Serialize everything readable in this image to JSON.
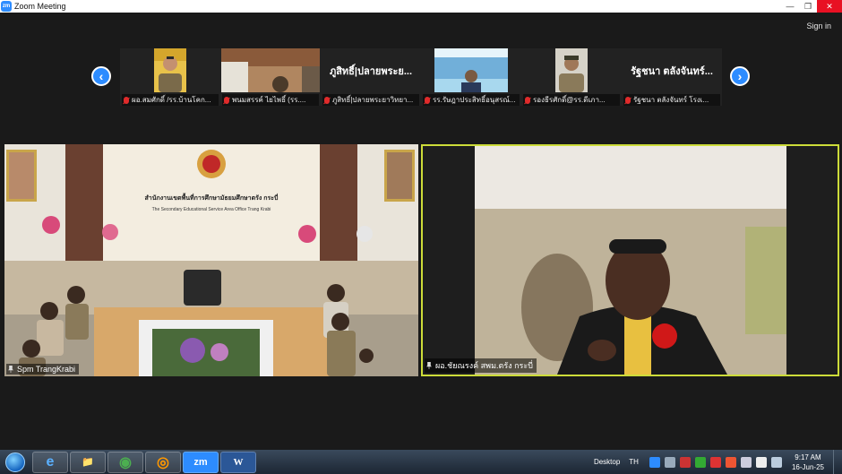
{
  "titlebar": {
    "app_icon_text": "zm",
    "title": "Zoom Meeting",
    "minimize": "—",
    "maximize": "❐",
    "close": "✕"
  },
  "header": {
    "signin": "Sign in"
  },
  "nav": {
    "prev": "‹",
    "next": "›"
  },
  "thumbnails": [
    {
      "name": "ผอ.สมศักดิ์ /รร.บ้านโคก...",
      "muted": true
    },
    {
      "name": "พนมสรรค์ ไยไพธิ์ (รร....",
      "muted": true
    },
    {
      "name": "ภูสิทธิ์|ปลายพระยาวิทยา...",
      "title": "ภูสิทธิ์|ปลายพระย...",
      "muted": true
    },
    {
      "name": "รร.รัษฎาประสิทธิ์อนุสรณ์...",
      "muted": true
    },
    {
      "name": "รองธีรศักดิ์@รร.ดีเภา...",
      "muted": true
    },
    {
      "name": "รัฐชนา ตลังจันทร์ โรงเ...",
      "title": "รัฐชนา ตลังจันทร์...",
      "muted": true
    }
  ],
  "tiles": {
    "left": {
      "label": "Spm TrangKrabi",
      "sign_th": "สำนักงานเขตพื้นที่การศึกษามัธยมศึกษาตรัง กระบี่",
      "sign_en": "The Secondary Educational Service Area Office Trang Krabi"
    },
    "right": {
      "label": "ผอ.ชัยณรงค์ สพม.ตรัง กระบี่"
    }
  },
  "taskbar": {
    "apps": [
      "e",
      "📁",
      "◉",
      "◎",
      "zm",
      "W"
    ],
    "desktop": "Desktop",
    "lang": "TH",
    "time": "9:17 AM",
    "date": "16-Jun-25"
  },
  "colors": {
    "accent": "#2d8cff",
    "active_speaker": "#cddc39",
    "muted": "#e02b2b"
  }
}
